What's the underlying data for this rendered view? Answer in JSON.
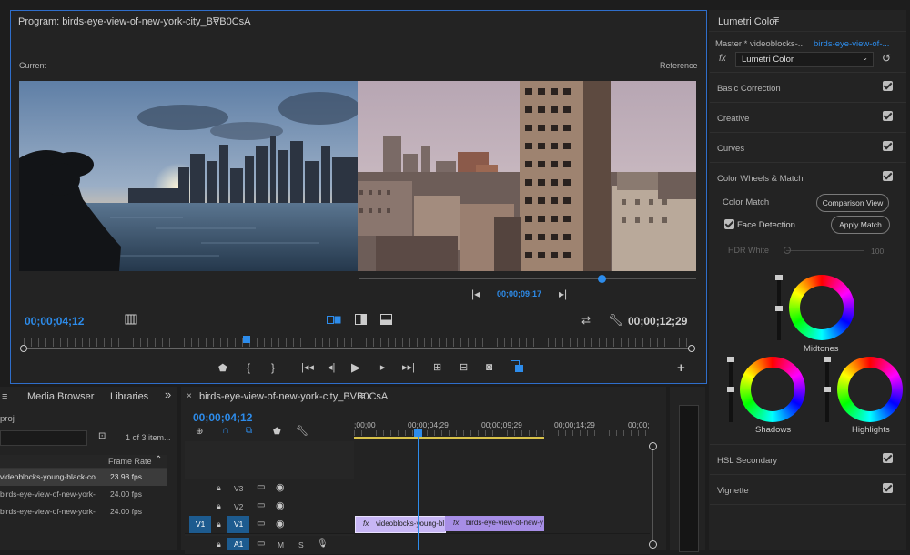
{
  "program": {
    "title": "Program: birds-eye-view-of-new-york-city_BVB0CsA",
    "current_label": "Current",
    "reference_label": "Reference",
    "ref_timecode": "00;00;09;17",
    "left_timecode": "00;00;04;12",
    "right_timecode": "00;00;12;29",
    "ref_scrub_fraction": 0.72
  },
  "lumetri": {
    "panel_title": "Lumetri Color",
    "master_label": "Master * videoblocks-...",
    "clip_label": "birds-eye-view-of-...",
    "fx_label": "fx",
    "effect_select": "Lumetri Color",
    "sections": {
      "basic": "Basic Correction",
      "creative": "Creative",
      "curves": "Curves",
      "wheels": "Color Wheels & Match",
      "hsl": "HSL Secondary",
      "vignette": "Vignette"
    },
    "color_match_label": "Color Match",
    "comparison_view_button": "Comparison View",
    "face_detection_label": "Face Detection",
    "apply_match_button": "Apply Match",
    "hdr_white_label": "HDR White",
    "hdr_white_value": "100",
    "midtones_label": "Midtones",
    "shadows_label": "Shadows",
    "highlights_label": "Highlights"
  },
  "project": {
    "tab_media_browser": "Media Browser",
    "tab_libraries": "Libraries",
    "overflow": "»",
    "proj_label": "proj",
    "item_count": "1 of 3 item...",
    "col_frame_rate": "Frame Rate",
    "rows": [
      {
        "name": "videoblocks-young-black-co",
        "fps": "23.98 fps"
      },
      {
        "name": "birds-eye-view-of-new-york-",
        "fps": "24.00 fps"
      },
      {
        "name": "birds-eye-view-of-new-york-",
        "fps": "24.00 fps"
      }
    ]
  },
  "timeline": {
    "close": "×",
    "title": "birds-eye-view-of-new-york-city_BVB0CsA",
    "timecode": "00;00;04;12",
    "ruler": [
      ";00;00",
      "00;00;04;29",
      "00;00;09;29",
      "00;00;14;29",
      "00;00;"
    ],
    "tracks": {
      "v3": "V3",
      "v2": "V2",
      "v1_src": "V1",
      "v1": "V1",
      "a1": "A1",
      "mute": "M",
      "solo": "S"
    },
    "fx": "fx",
    "clip1": "videoblocks-young-bl",
    "clip2": "birds-eye-view-of-new-y"
  },
  "colors": {
    "accent": "#2d8ceb",
    "clip": "#a78ee6",
    "clip_selected": "#c7b6f5"
  }
}
